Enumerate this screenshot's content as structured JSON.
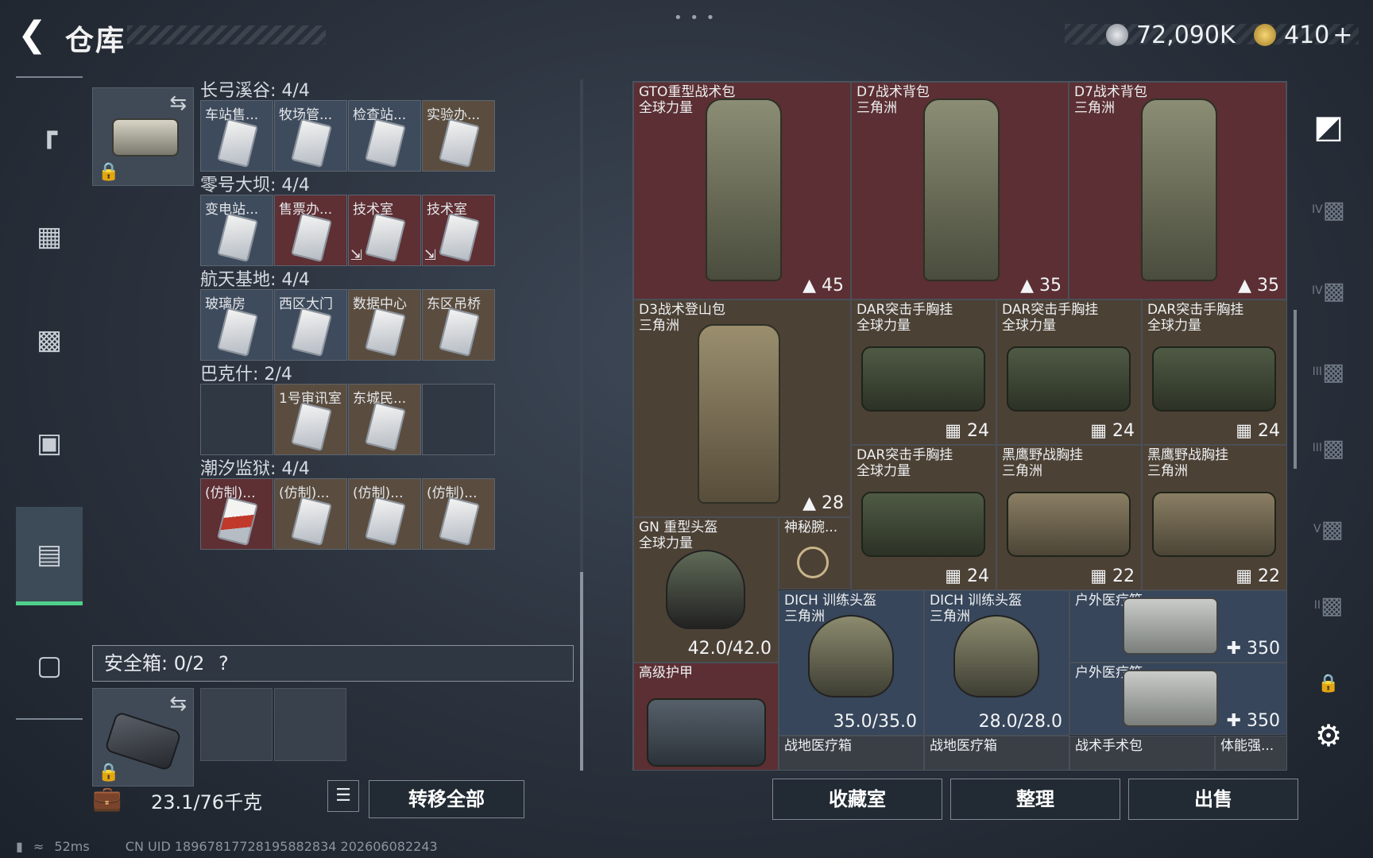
{
  "header": {
    "back_icon": "back-arrow-icon",
    "title": "仓库",
    "menu_dots": "• • •",
    "currency1": "72,090K",
    "currency2": "410",
    "currency2_plus": "+"
  },
  "left_nav": [
    "gun-icon",
    "vest-icon",
    "chestrig-icon",
    "backpack-icon",
    "keycard-case-icon",
    "toolbox-icon"
  ],
  "key_groups": [
    {
      "title": "长弓溪谷: 4/4",
      "slots": [
        {
          "label": "车站售...",
          "color": "blue"
        },
        {
          "label": "牧场管...",
          "color": "blue"
        },
        {
          "label": "检查站...",
          "color": "blue"
        },
        {
          "label": "实验办...",
          "color": "brown"
        }
      ]
    },
    {
      "title": "零号大坝: 4/4",
      "slots": [
        {
          "label": "变电站...",
          "color": "blue"
        },
        {
          "label": "售票办...",
          "color": "red"
        },
        {
          "label": "技术室",
          "color": "red",
          "cross": "⇲"
        },
        {
          "label": "技术室",
          "color": "red",
          "cross": "⇲"
        }
      ]
    },
    {
      "title": "航天基地: 4/4",
      "slots": [
        {
          "label": "玻璃房",
          "color": "blue"
        },
        {
          "label": "西区大门",
          "color": "blue"
        },
        {
          "label": "数据中心",
          "color": "brown"
        },
        {
          "label": "东区吊桥",
          "color": "brown"
        }
      ]
    },
    {
      "title": "巴克什: 2/4",
      "slots": [
        {
          "label": "",
          "color": "empty"
        },
        {
          "label": "1号审讯室",
          "color": "brown"
        },
        {
          "label": "东城民...",
          "color": "brown"
        },
        {
          "label": "",
          "color": "empty"
        }
      ]
    },
    {
      "title": "潮汐监狱: 4/4",
      "slots": [
        {
          "label": "(仿制)...",
          "color": "red"
        },
        {
          "label": "(仿制)...",
          "color": "brown"
        },
        {
          "label": "(仿制)...",
          "color": "brown"
        },
        {
          "label": "(仿制)...",
          "color": "brown"
        }
      ]
    }
  ],
  "safe_box": {
    "label": "安全箱:  0/2",
    "help": "?"
  },
  "footer_left": {
    "weight": "23.1/76千克",
    "transfer_all": "转移全部"
  },
  "items": {
    "gto": {
      "name1": "GTO重型战术包",
      "name2": "全球力量",
      "qty": "45"
    },
    "d7a": {
      "name1": "D7战术背包",
      "name2": "三角洲",
      "qty": "35"
    },
    "d7b": {
      "name1": "D7战术背包",
      "name2": "三角洲",
      "qty": "35"
    },
    "d3": {
      "name1": "D3战术登山包",
      "name2": "三角洲",
      "qty": "28"
    },
    "dar1": {
      "name1": "DAR突击手胸挂",
      "name2": "全球力量",
      "qty": "24"
    },
    "dar2": {
      "name1": "DAR突击手胸挂",
      "name2": "全球力量",
      "qty": "24"
    },
    "dar3": {
      "name1": "DAR突击手胸挂",
      "name2": "全球力量",
      "qty": "24"
    },
    "dar4": {
      "name1": "DAR突击手胸挂",
      "name2": "全球力量",
      "qty": "24"
    },
    "hy1": {
      "name1": "黑鹰野战胸挂",
      "name2": "三角洲",
      "qty": "22"
    },
    "hy2": {
      "name1": "黑鹰野战胸挂",
      "name2": "三角洲",
      "qty": "22"
    },
    "gn": {
      "name1": "GN 重型头盔",
      "name2": "全球力量",
      "qty": "42.0/42.0"
    },
    "mystery": {
      "name1": "神秘腕..."
    },
    "dich1": {
      "name1": "DICH 训练头盔",
      "name2": "三角洲",
      "qty": "35.0/35.0"
    },
    "dich2": {
      "name1": "DICH 训练头盔",
      "name2": "三角洲",
      "qty": "28.0/28.0"
    },
    "med1": {
      "name1": "户外医疗箱",
      "qty": "350"
    },
    "med2": {
      "name1": "户外医疗箱",
      "qty": "350"
    },
    "armor": {
      "name1": "高级护甲"
    },
    "fmed1": {
      "name1": "战地医疗箱"
    },
    "fmed2": {
      "name1": "战地医疗箱"
    },
    "surg": {
      "name1": "战术手术包"
    },
    "stam": {
      "name1": "体能强..."
    }
  },
  "footer_right": {
    "collection": "收藏室",
    "sort": "整理",
    "sell": "出售"
  },
  "right_nav": [
    {
      "icon": "storage-icon",
      "tier": ""
    },
    {
      "icon": "case-tier-iv-icon",
      "tier": "IV"
    },
    {
      "icon": "case-tier-iv-icon",
      "tier": "IV"
    },
    {
      "icon": "case-tier-iii-icon",
      "tier": "III"
    },
    {
      "icon": "case-tier-iii-icon",
      "tier": "III"
    },
    {
      "icon": "case-tier-v-icon",
      "tier": "V"
    },
    {
      "icon": "case-tier-ii-icon",
      "tier": "II"
    },
    {
      "icon": "lock-icon",
      "tier": ""
    },
    {
      "icon": "settings-gear-icon",
      "tier": ""
    }
  ],
  "status": {
    "ping": "52ms",
    "uid": "CN UID 18967817728195882834  202606082243"
  },
  "colors": {
    "accent_green": "#4fd18b",
    "slot_red": "#5b2f33",
    "slot_brown": "#4c4135",
    "slot_blue": "#37465a"
  }
}
